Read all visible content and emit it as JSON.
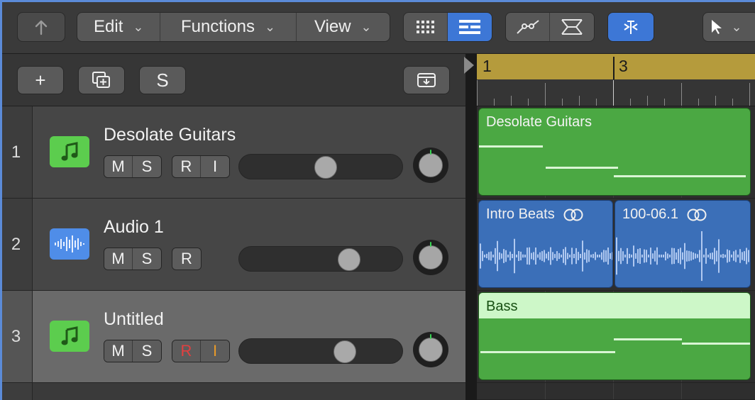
{
  "toolbar": {
    "back_label": "",
    "menus": [
      {
        "label": "Edit"
      },
      {
        "label": "Functions"
      },
      {
        "label": "View"
      }
    ]
  },
  "track_tools": {
    "add_label": "+",
    "duplicate_label": "",
    "s_label": "S",
    "download_label": ""
  },
  "tracks": [
    {
      "number": "1",
      "name": "Desolate Guitars",
      "type": "software-instrument",
      "icon": "music-note-icon",
      "icon_color": "#5ccd4e",
      "buttons": [
        "M",
        "S",
        "R",
        "I"
      ],
      "volume": 0.53,
      "record_color": "",
      "selected": false
    },
    {
      "number": "2",
      "name": "Audio 1",
      "type": "audio",
      "icon": "waveform-icon",
      "icon_color": "#4f8de8",
      "buttons": [
        "M",
        "S",
        "R"
      ],
      "volume": 0.7,
      "selected": false
    },
    {
      "number": "3",
      "name": "Untitled",
      "type": "software-instrument",
      "icon": "music-note-icon",
      "icon_color": "#5ccd4e",
      "buttons": [
        "M",
        "S",
        "R",
        "I"
      ],
      "volume": 0.67,
      "selected": true,
      "record_armed": true
    }
  ],
  "ruler": {
    "bars": [
      "1",
      "3"
    ],
    "cycle_color": "#b59b3c"
  },
  "regions": [
    {
      "track": 1,
      "name": "Desolate Guitars",
      "kind": "midi"
    },
    {
      "track": 2,
      "name": "Intro Beats",
      "kind": "audio",
      "looped": true
    },
    {
      "track": 2,
      "name": "100-06.1",
      "kind": "audio",
      "looped": true
    },
    {
      "track": 3,
      "name": "Bass",
      "kind": "midi"
    }
  ],
  "colors": {
    "accent": "#3d77d6",
    "midi_region": "#4ba843",
    "audio_region": "#3b6fb8"
  }
}
